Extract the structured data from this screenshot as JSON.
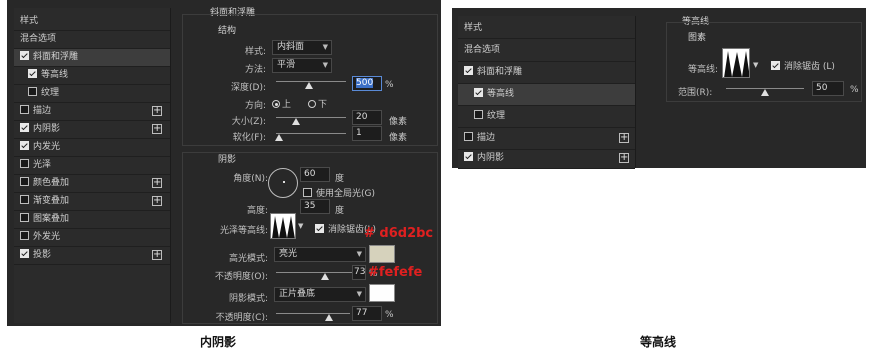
{
  "left": {
    "list": {
      "header": "样式",
      "blend_options": "混合选项",
      "items": [
        {
          "label": "斜面和浮雕",
          "checked": true
        },
        {
          "label": "等高线",
          "checked": true
        },
        {
          "label": "纹理",
          "checked": false
        },
        {
          "label": "描边",
          "checked": false
        },
        {
          "label": "内阴影",
          "checked": true
        },
        {
          "label": "内发光",
          "checked": true
        },
        {
          "label": "光泽",
          "checked": false
        },
        {
          "label": "颜色叠加",
          "checked": false
        },
        {
          "label": "渐变叠加",
          "checked": false
        },
        {
          "label": "图案叠加",
          "checked": false
        },
        {
          "label": "外发光",
          "checked": false
        },
        {
          "label": "投影",
          "checked": true
        }
      ]
    },
    "bevel": {
      "title": "斜面和浮雕",
      "structure": "结构",
      "style_label": "样式:",
      "style_value": "内斜面",
      "method_label": "方法:",
      "method_value": "平滑",
      "depth_label": "深度(D):",
      "depth_value": "500",
      "depth_unit": "%",
      "direction_label": "方向:",
      "dir_up": "上",
      "dir_down": "下",
      "size_label": "大小(Z):",
      "size_value": "20",
      "size_unit": "像素",
      "soften_label": "软化(F):",
      "soften_value": "1",
      "soften_unit": "像素"
    },
    "shading": {
      "title": "阴影",
      "angle_label": "角度(N):",
      "angle_value": "60",
      "angle_unit": "度",
      "global_light": "使用全局光(G)",
      "altitude_label": "高度:",
      "altitude_value": "35",
      "altitude_unit": "度",
      "gloss_label": "光泽等高线:",
      "antialias": "消除锯齿(L)",
      "highlight_label": "高光模式:",
      "highlight_value": "亮光",
      "highlight_color": "#d6d2bc",
      "hl_opacity_label": "不透明度(O):",
      "hl_opacity_value": "73",
      "hl_opacity_unit": "%",
      "shadow_label": "阴影模式:",
      "shadow_value": "正片叠底",
      "shadow_color": "#fefefe",
      "sh_opacity_label": "不透明度(C):",
      "sh_opacity_value": "77",
      "sh_opacity_unit": "%"
    },
    "annotations": {
      "highlight": "# d6d2bc",
      "shadow": "#fefefe"
    },
    "caption": "内阴影"
  },
  "right": {
    "list": {
      "header": "样式",
      "blend_options": "混合选项",
      "items": [
        {
          "label": "斜面和浮雕",
          "checked": true
        },
        {
          "label": "等高线",
          "checked": true
        },
        {
          "label": "纹理",
          "checked": false
        },
        {
          "label": "描边",
          "checked": false
        },
        {
          "label": "内阴影",
          "checked": true
        }
      ]
    },
    "contour": {
      "title": "等高线",
      "group": "图素",
      "contour_label": "等高线:",
      "antialias": "消除锯齿 (L)",
      "range_label": "范围(R):",
      "range_value": "50",
      "range_unit": "%"
    },
    "caption": "等高线"
  }
}
